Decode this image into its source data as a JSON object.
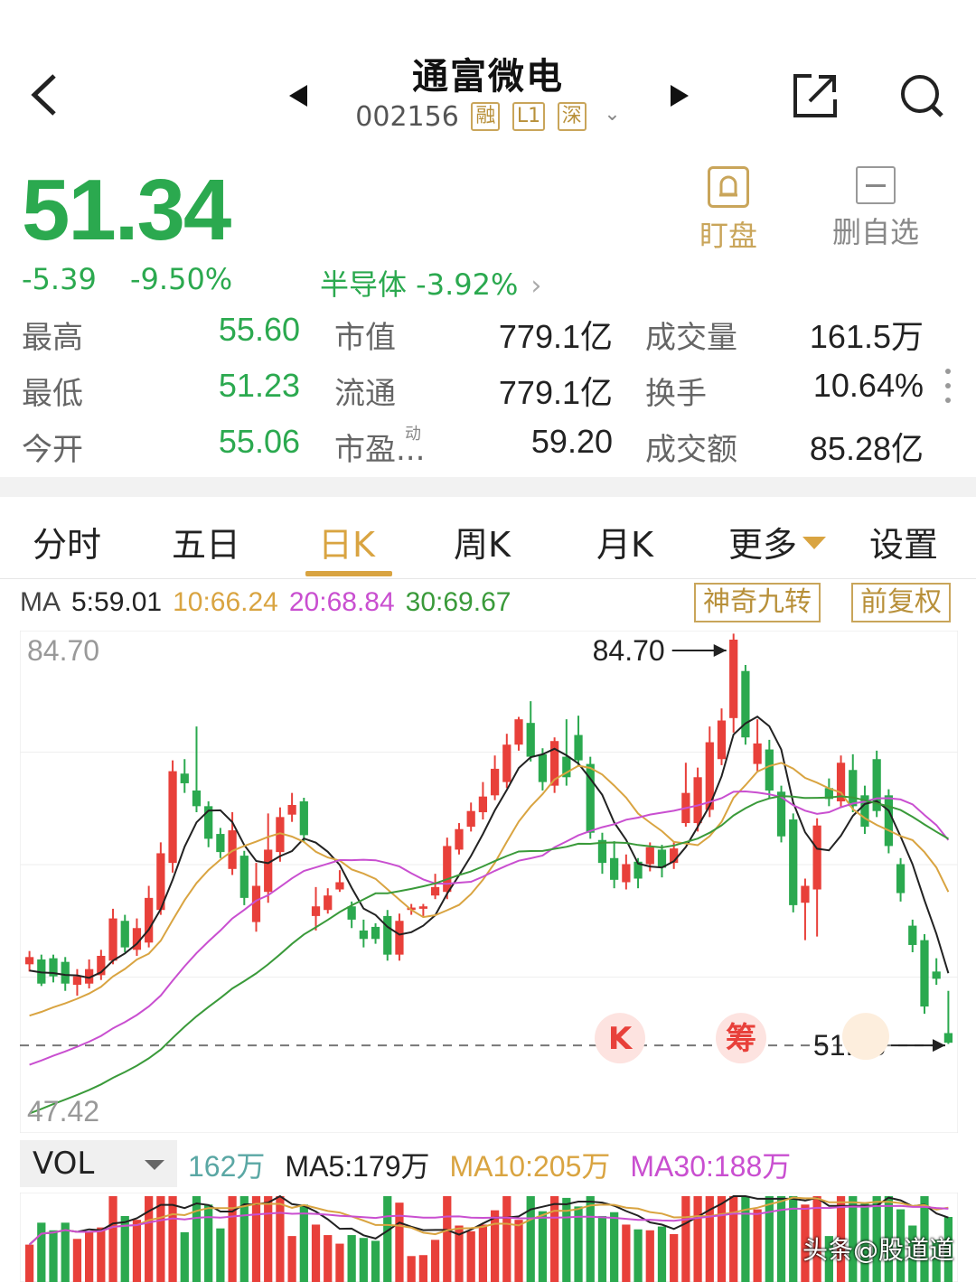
{
  "header": {
    "title": "通富微电",
    "code": "002156",
    "tags": [
      "融",
      "L1",
      "深"
    ]
  },
  "quote": {
    "price": "51.34",
    "change": "-5.39",
    "change_pct": "-9.50%",
    "sector": "半导体 -3.92%",
    "price_color": "#2ba94f"
  },
  "actions": {
    "watch_label": "盯盘",
    "remove_label": "删自选"
  },
  "stats": {
    "high_label": "最高",
    "high": "55.60",
    "low_label": "最低",
    "low": "51.23",
    "open_label": "今开",
    "open": "55.06",
    "mcap_label": "市值",
    "mcap": "779.1亿",
    "float_label": "流通",
    "float": "779.1亿",
    "pe_label": "市盈...",
    "pe_sup": "动",
    "pe": "59.20",
    "vol_label": "成交量",
    "vol": "161.5万",
    "turnover_label": "换手",
    "turnover": "10.64%",
    "amount_label": "成交额",
    "amount": "85.28亿"
  },
  "tabs": [
    {
      "label": "分时"
    },
    {
      "label": "五日"
    },
    {
      "label": "日K"
    },
    {
      "label": "周K"
    },
    {
      "label": "月K"
    },
    {
      "label": "更多"
    },
    {
      "label": "设置"
    }
  ],
  "ma_legend": {
    "ma": "MA",
    "ma5": "5:59.01",
    "ma10": "10:66.24",
    "ma20": "20:68.84",
    "ma30": "30:69.67",
    "btn_magic": "神奇九转",
    "btn_adjust": "前复权"
  },
  "chart_data": {
    "type": "candlestick",
    "y_max_label": "84.70",
    "y_min_label": "47.42",
    "ylim": [
      47.42,
      84.7
    ],
    "high_marker": "84.70",
    "low_marker": "51.23",
    "markers": [
      "K",
      "筹"
    ],
    "colors": {
      "up": "#e8403a",
      "down": "#2ba94f",
      "ma5": "#222222",
      "ma10": "#d9a441",
      "ma20": "#c94fd0",
      "ma30": "#3a9a3a"
    },
    "candles": [
      [
        57.8,
        58.4,
        58.9,
        57.2
      ],
      [
        58.2,
        56.2,
        58.6,
        56.0
      ],
      [
        58.3,
        56.8,
        58.6,
        56.3
      ],
      [
        58.0,
        56.2,
        58.4,
        55.6
      ],
      [
        56.1,
        56.8,
        57.4,
        55.2
      ],
      [
        56.2,
        57.4,
        58.2,
        55.8
      ],
      [
        56.9,
        58.5,
        59.0,
        56.5
      ],
      [
        58.1,
        61.6,
        62.4,
        57.8
      ],
      [
        61.4,
        59.2,
        61.9,
        58.8
      ],
      [
        59.0,
        60.8,
        61.6,
        58.5
      ],
      [
        59.6,
        63.3,
        64.3,
        59.2
      ],
      [
        62.3,
        67.0,
        67.9,
        61.9
      ],
      [
        66.2,
        73.8,
        74.7,
        65.4
      ],
      [
        73.6,
        72.8,
        74.8,
        72.0
      ],
      [
        72.2,
        70.9,
        77.5,
        70.4
      ],
      [
        70.9,
        68.2,
        71.3,
        67.5
      ],
      [
        68.6,
        67.1,
        69.1,
        66.6
      ],
      [
        65.7,
        68.9,
        70.4,
        65.2
      ],
      [
        66.8,
        63.3,
        67.2,
        62.7
      ],
      [
        61.3,
        64.3,
        66.2,
        60.5
      ],
      [
        63.8,
        67.3,
        70.3,
        62.9
      ],
      [
        67.1,
        70.0,
        70.8,
        66.3
      ],
      [
        70.2,
        71.0,
        72.0,
        69.6
      ],
      [
        71.3,
        68.5,
        71.6,
        67.9
      ],
      [
        61.8,
        62.6,
        64.2,
        60.6
      ],
      [
        62.3,
        63.5,
        64.1,
        62.0
      ],
      [
        64.0,
        64.6,
        65.6,
        63.8
      ],
      [
        62.6,
        61.5,
        63.0,
        60.8
      ],
      [
        60.6,
        59.9,
        61.5,
        59.2
      ],
      [
        60.9,
        59.9,
        61.2,
        59.5
      ],
      [
        61.8,
        58.6,
        62.3,
        58.1
      ],
      [
        58.6,
        61.4,
        62.0,
        58.1
      ],
      [
        62.3,
        62.5,
        62.8,
        61.9
      ],
      [
        62.4,
        62.6,
        62.8,
        61.8
      ],
      [
        63.5,
        64.2,
        65.3,
        63.2
      ],
      [
        63.8,
        67.6,
        68.3,
        63.2
      ],
      [
        67.3,
        69.0,
        69.5,
        66.9
      ],
      [
        69.2,
        70.5,
        71.2,
        68.8
      ],
      [
        70.4,
        71.7,
        72.9,
        69.8
      ],
      [
        71.8,
        74.0,
        75.1,
        71.4
      ],
      [
        72.9,
        76.0,
        76.9,
        72.4
      ],
      [
        76.0,
        78.1,
        78.3,
        75.5
      ],
      [
        77.8,
        75.0,
        79.6,
        74.6
      ],
      [
        75.2,
        72.9,
        75.7,
        72.2
      ],
      [
        72.6,
        76.3,
        76.6,
        72.0
      ],
      [
        75.0,
        73.3,
        78.1,
        72.6
      ],
      [
        76.8,
        74.7,
        78.4,
        74.2
      ],
      [
        74.4,
        68.7,
        75.0,
        68.2
      ],
      [
        68.1,
        66.2,
        68.7,
        65.3
      ],
      [
        66.6,
        64.8,
        68.0,
        64.1
      ],
      [
        64.6,
        66.1,
        66.9,
        64.0
      ],
      [
        66.3,
        64.9,
        66.6,
        64.1
      ],
      [
        66.1,
        67.5,
        67.9,
        65.5
      ],
      [
        67.3,
        65.8,
        67.7,
        65.0
      ],
      [
        66.2,
        67.4,
        67.9,
        65.7
      ],
      [
        69.5,
        72.0,
        74.5,
        69.2
      ],
      [
        69.5,
        73.3,
        74.1,
        68.8
      ],
      [
        70.6,
        76.2,
        77.5,
        70.0
      ],
      [
        74.8,
        78.0,
        79.0,
        74.3
      ],
      [
        78.2,
        84.7,
        85.2,
        77.0
      ],
      [
        82.1,
        76.6,
        82.6,
        76.0
      ],
      [
        74.4,
        76.1,
        78.1,
        73.8
      ],
      [
        75.6,
        72.2,
        76.4,
        71.5
      ],
      [
        72.1,
        68.4,
        72.6,
        67.9
      ],
      [
        69.8,
        62.7,
        70.3,
        62.1
      ],
      [
        62.9,
        64.3,
        64.9,
        59.8
      ],
      [
        64.0,
        69.3,
        69.9,
        60.1
      ],
      [
        72.4,
        71.5,
        73.2,
        70.9
      ],
      [
        71.3,
        74.5,
        75.1,
        70.8
      ],
      [
        73.9,
        70.9,
        75.2,
        70.4
      ],
      [
        71.8,
        69.2,
        72.6,
        68.6
      ],
      [
        74.8,
        70.5,
        75.5,
        70.0
      ],
      [
        71.8,
        67.6,
        72.3,
        67.0
      ],
      [
        66.1,
        63.7,
        66.6,
        63.0
      ],
      [
        61.0,
        59.4,
        61.5,
        58.8
      ],
      [
        59.8,
        54.3,
        60.3,
        53.7
      ],
      [
        57.2,
        56.6,
        58.3,
        56.1
      ],
      [
        52.1,
        51.3,
        55.6,
        51.2
      ]
    ]
  },
  "vol": {
    "label": "VOL",
    "current": "162万",
    "ma5": "MA5:179万",
    "ma10": "MA10:205万",
    "ma30": "MA30:188万"
  },
  "watermark": "头条@股道道"
}
